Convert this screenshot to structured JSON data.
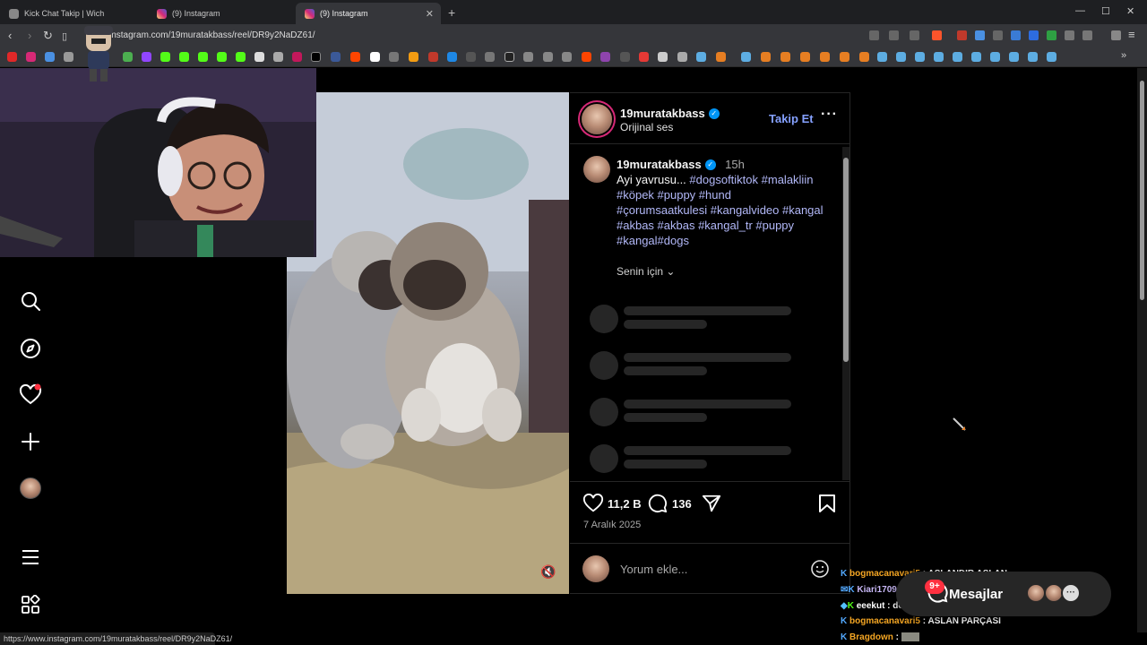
{
  "browser": {
    "tabs": [
      {
        "title": "Kick Chat Takip | Wich",
        "active": false
      },
      {
        "title": "(9) Instagram",
        "active": false
      },
      {
        "title": "(9) Instagram",
        "active": true
      }
    ],
    "url": "instagram.com/19muratakbass/reel/DR9y2NaDZ61/",
    "status_url": "https://www.instagram.com/19muratakbass/reel/DR9y2NaDZ61/"
  },
  "post": {
    "header_username": "19muratakbass",
    "audio": "Orijinal ses",
    "follow_label": "Takip Et",
    "caption_username": "19muratakbass",
    "time_ago": "15h",
    "caption_text": "Ayi yavrusu...",
    "hashtags_line1": "#dogsoftiktok #malakliin",
    "hashtags_line2": "#köpek #puppy #hund",
    "hashtags_line3": "#çorumsaatkulesi #kangalvideo #kangal",
    "hashtags_line4": "#akbas #akbas #kangal_tr #puppy",
    "hashtags_line5": "#kangal#dogs",
    "for_you": "Senin için",
    "likes": "11,2 B",
    "comments": "136",
    "date": "7 Aralık 2025",
    "comment_placeholder": "Yorum ekle..."
  },
  "chat": [
    {
      "user": "bogmacanavari5",
      "msg": "ASLANDIR ASLAN",
      "color": "#f5a623"
    },
    {
      "user": "Kiari1709",
      "msg": "",
      "color": "#c7b7f5"
    },
    {
      "user": "eeekut",
      "msg": "dev enik",
      "color": "#ffffff"
    },
    {
      "user": "bogmacanavari5",
      "msg": "ASLAN PARÇASI",
      "color": "#f5a623"
    },
    {
      "user": "Bragdown",
      "msg": "",
      "color": "#f5a623"
    }
  ],
  "messages": {
    "label": "Mesajlar",
    "badge": "9+"
  },
  "colors": {
    "accent_blue": "#0095f6",
    "hashtag": "#b2b8f8",
    "notification_red": "#ff3040"
  }
}
